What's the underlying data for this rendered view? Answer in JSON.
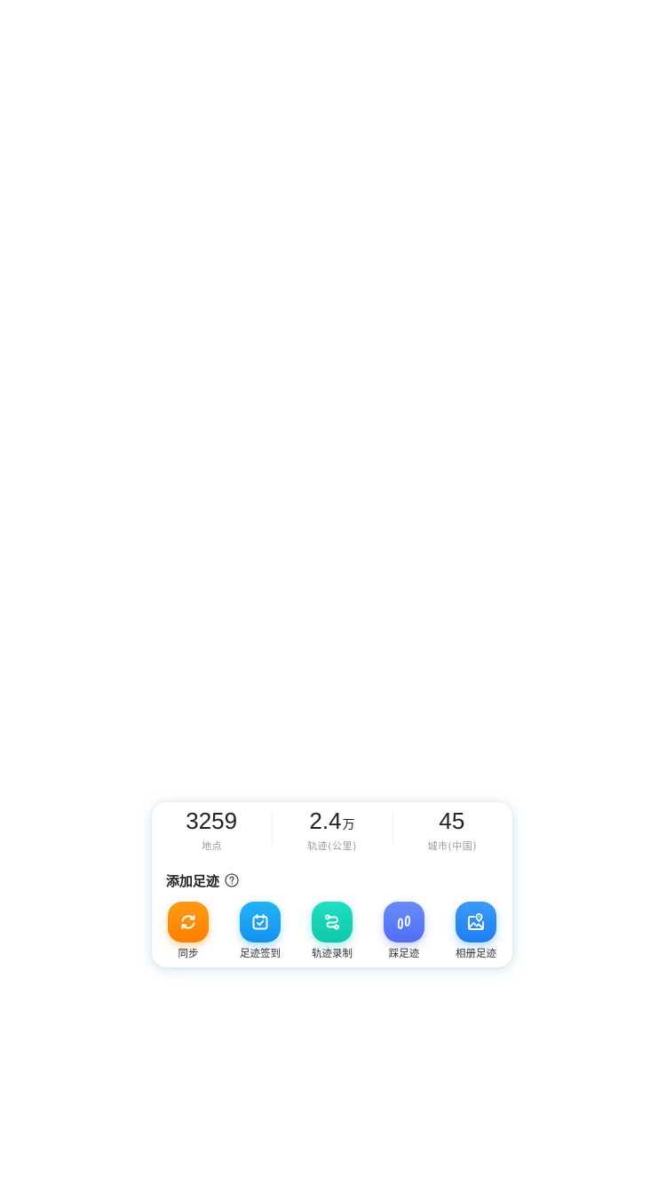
{
  "stats": [
    {
      "value": "3259",
      "unit": "",
      "label": "地点"
    },
    {
      "value": "2.4",
      "unit": "万",
      "label": "轨迹(公里)"
    },
    {
      "value": "45",
      "unit": "",
      "label": "城市(中国)"
    }
  ],
  "section": {
    "title": "添加足迹",
    "help_icon": "question-circle-icon"
  },
  "actions": [
    {
      "label": "同步",
      "icon": "sync-icon",
      "color": "#ff8a00"
    },
    {
      "label": "足迹签到",
      "icon": "calendar-check-icon",
      "color": "#1ea3f2"
    },
    {
      "label": "轨迹录制",
      "icon": "route-icon",
      "color": "#16d2b4"
    },
    {
      "label": "踩足迹",
      "icon": "footprints-icon",
      "color": "#5b7cf7"
    },
    {
      "label": "相册足迹",
      "icon": "photo-map-icon",
      "color": "#2a8cf6"
    }
  ]
}
